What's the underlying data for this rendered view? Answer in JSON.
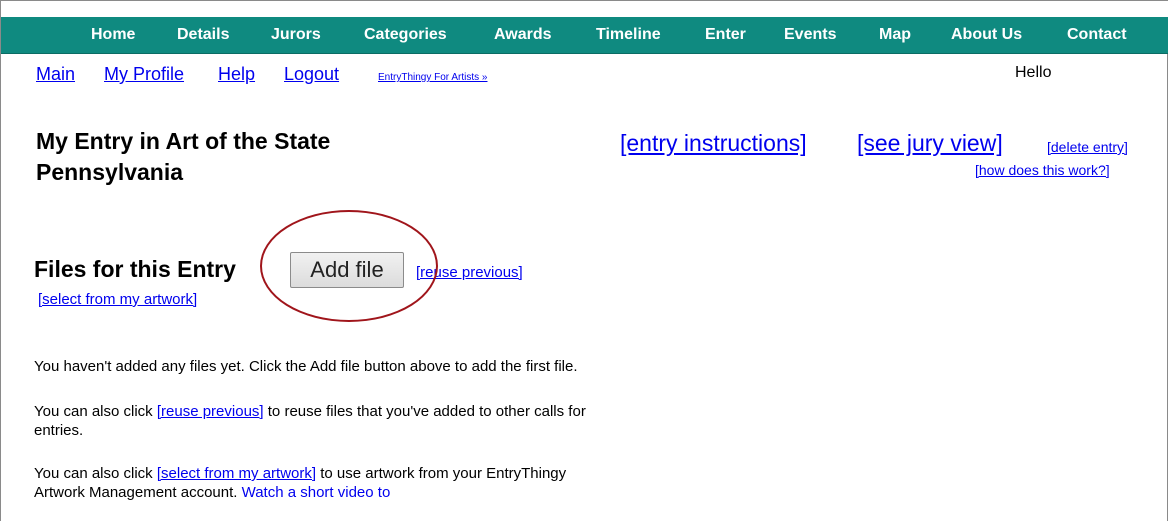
{
  "nav": {
    "items": [
      "Home",
      "Details",
      "Jurors",
      "Categories",
      "Awards",
      "Timeline",
      "Enter",
      "Events",
      "Map",
      "About Us",
      "Contact"
    ]
  },
  "subnav": {
    "main": "Main",
    "my_profile": "My Profile",
    "help": "Help",
    "logout": "Logout",
    "artists_link": "EntryThingy For Artists »",
    "greeting": "Hello"
  },
  "entry": {
    "title": "My Entry in Art of the State Pennsylvania",
    "instructions_link": "[entry instructions]",
    "jury_link": "[see jury view]",
    "delete_link": "[delete entry]",
    "how_link": "[how does this work?]"
  },
  "files": {
    "heading": "Files for this Entry",
    "add_button": "Add file",
    "reuse_link": "[reuse previous]",
    "select_link": "[select from my artwork]",
    "empty_msg": "You haven't added any files yet. Click the Add file button above to add the first file.",
    "reuse_prefix": "You can also click",
    "reuse_suffix": "to reuse files that you've added to other calls for entries.",
    "select_prefix": "You can also click",
    "select_suffix": "to use artwork from your EntryThingy Artwork Management account.",
    "video_link": "Watch a short video to"
  },
  "colors": {
    "navbar": "#0f8a80",
    "link": "#0000ee",
    "highlight_circle": "#a0151b"
  }
}
